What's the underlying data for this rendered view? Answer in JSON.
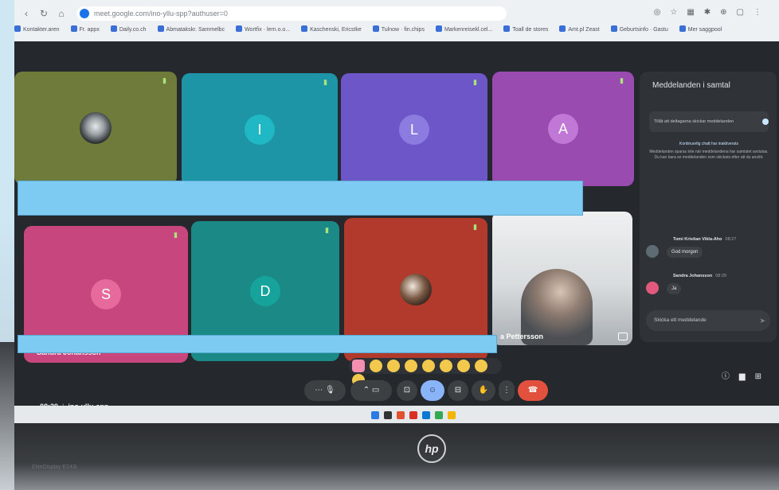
{
  "browser": {
    "url": "meet.google.com/ino-yllu-spp?authuser=0",
    "bookmarks": [
      "Kontakter.aren",
      "Fr. appx",
      "Daily.co.ch",
      "Abmatakskr. Sammelbc",
      "Wortfix · lern.o.o...",
      "Kaschenski, Ericstke",
      "Tulnow · fin.chips",
      "Markenreisekl.cel...",
      "Toall de stores",
      "Amt.pl Zeast",
      "Geburtsinfo · Gastu",
      "Mer saggpool"
    ]
  },
  "tiles": {
    "row1": [
      {
        "initial": "",
        "color": "#6f7b3a"
      },
      {
        "initial": "I",
        "color": "#1e95a6"
      },
      {
        "initial": "L",
        "color": "#6d56c7"
      },
      {
        "initial": "A",
        "color": "#9a4bb0"
      }
    ],
    "row2": [
      {
        "initial": "S",
        "color": "#c8467e",
        "name": "Sandra Johansson"
      },
      {
        "initial": "D",
        "color": "#1b8a86"
      },
      {
        "initial": "",
        "color": "#b23a2c"
      },
      {
        "initial": "",
        "color": "#cfd3d6",
        "name": "a Pettersson"
      }
    ]
  },
  "chat": {
    "title": "Meddelanden i samtal",
    "toggle_label": "Tillåt att deltagarna skickar meddelanden",
    "note_heading": "Kontinuerlig chatt har inaktiverats",
    "note_body": "Meddelanden sparas inte när meddelandena har samtalet avslutas. Du kan bara se meddelanden som skickats efter att du anslöt.",
    "messages": [
      {
        "author": "Tomi Kristian Vikla-Aho",
        "time": "08:27",
        "text": "God morgon",
        "avatar_color": "#5f6b73"
      },
      {
        "author": "Sandra Johansson",
        "time": "08:29",
        "text": "Ja",
        "avatar_color": "#e2597e"
      }
    ],
    "input_placeholder": "Skicka ett meddelande"
  },
  "meeting": {
    "time": "08:30",
    "code": "ino-yllu-spp"
  },
  "device": {
    "brand": "hp",
    "label": "EliteDisplay E243i"
  },
  "colors": {
    "cover_bar": "#7dcaf2",
    "hangup": "#e2513e",
    "active_control": "#8ab4f8"
  }
}
